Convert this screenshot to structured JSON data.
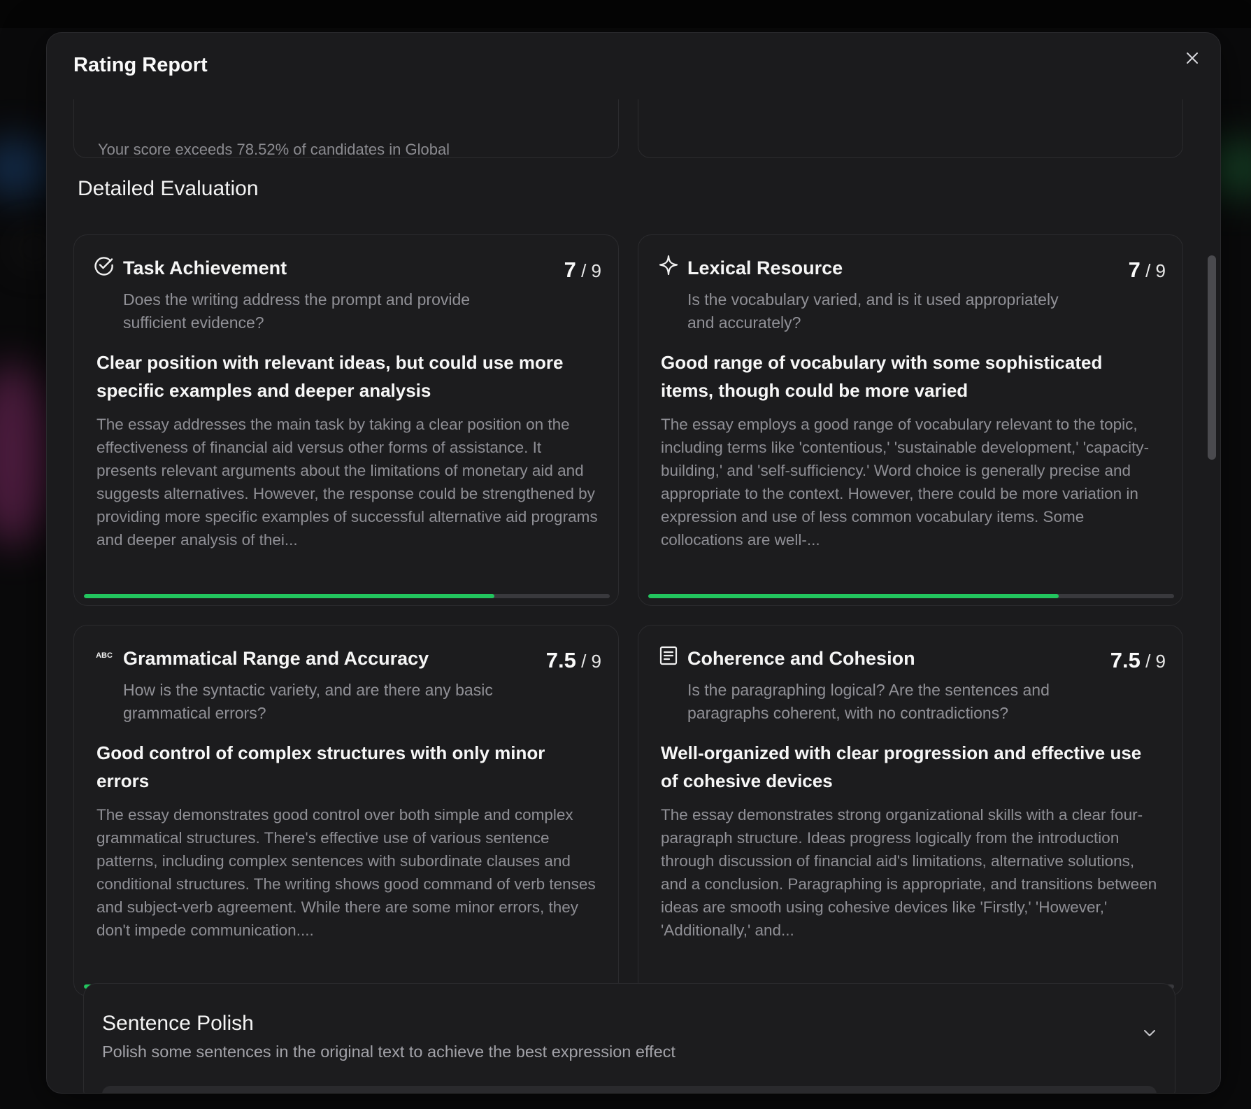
{
  "modal": {
    "title": "Rating Report",
    "close_icon": "close-icon"
  },
  "top": {
    "partial_text": "Your score exceeds 78.52% of candidates in Global"
  },
  "section": {
    "title": "Detailed Evaluation"
  },
  "criteria": [
    {
      "icon": "check-circle-icon",
      "name": "Task Achievement",
      "score": "7",
      "max": "/ 9",
      "progress": 0.78,
      "question": "Does the writing address the prompt and provide sufficient evidence?",
      "summary": "Clear position with relevant ideas, but could use more specific examples and deeper analysis",
      "detail": "The essay addresses the main task by taking a clear position on the effectiveness of financial aid versus other forms of assistance. It presents relevant arguments about the limitations of monetary aid and suggests alternatives. However, the response could be strengthened by providing more specific examples of successful alternative aid programs and deeper analysis of thei..."
    },
    {
      "icon": "sparkle-icon",
      "name": "Lexical Resource",
      "score": "7",
      "max": "/ 9",
      "progress": 0.78,
      "question": "Is the vocabulary varied, and is it used appropriately and accurately?",
      "summary": "Good range of vocabulary with some sophisticated items, though could be more varied",
      "detail": "The essay employs a good range of vocabulary relevant to the topic, including terms like 'contentious,' 'sustainable development,' 'capacity-building,' and 'self-sufficiency.' Word choice is generally precise and appropriate to the context. However, there could be more variation in expression and use of less common vocabulary items. Some collocations are well-..."
    },
    {
      "icon": "abc-icon",
      "icon_text": "ABC",
      "name": "Grammatical Range and Accuracy",
      "score": "7.5",
      "max": "/ 9",
      "progress": 0.83,
      "question": "How is the syntactic variety, and are there any basic grammatical errors?",
      "summary": "Good control of complex structures with only minor errors",
      "detail": "The essay demonstrates good control over both simple and complex grammatical structures. There's effective use of various sentence patterns, including complex sentences with subordinate clauses and conditional structures. The writing shows good command of verb tenses and subject-verb agreement. While there are some minor errors, they don't impede communication...."
    },
    {
      "icon": "document-icon",
      "name": "Coherence and Cohesion",
      "score": "7.5",
      "max": "/ 9",
      "progress": 0.83,
      "question": "Is the paragraphing logical? Are the sentences and paragraphs coherent, with no contradictions?",
      "summary": "Well-organized with clear progression and effective use of cohesive devices",
      "detail": "The essay demonstrates strong organizational skills with a clear four-paragraph structure. Ideas progress logically from the introduction through discussion of financial aid's limitations, alternative solutions, and a conclusion. Paragraphing is appropriate, and transitions between ideas are smooth using cohesive devices like 'Firstly,' 'However,' 'Additionally,' and..."
    }
  ],
  "polish": {
    "title": "Sentence Polish",
    "subtitle": "Polish some sentences in the original text to achieve the best expression effect",
    "chevron_icon": "chevron-down-icon"
  },
  "colors": {
    "accent": "#22c55e",
    "modal_bg": "#1b1b1d",
    "track": "#39393d"
  }
}
